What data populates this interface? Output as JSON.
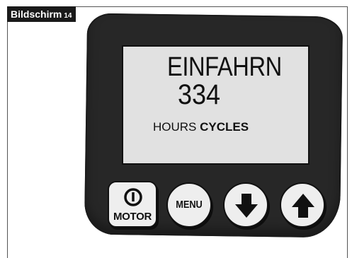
{
  "screen_label": {
    "title": "Bildschirm",
    "number": "14"
  },
  "display": {
    "line1": "EINFAHRN",
    "line2": "334",
    "line3_normal": "HOURS",
    "line3_bold": "CYCLES"
  },
  "buttons": {
    "motor": {
      "label": "MOTOR",
      "icon": "power-icon"
    },
    "menu": {
      "label": "MENU"
    },
    "down": {
      "icon": "arrow-down-icon"
    },
    "up": {
      "icon": "arrow-up-icon"
    }
  },
  "colors": {
    "device_body": "#272727",
    "lcd_background": "#e1e1e1",
    "button_face": "#eeeeee",
    "label_background": "#1a1a1a"
  }
}
